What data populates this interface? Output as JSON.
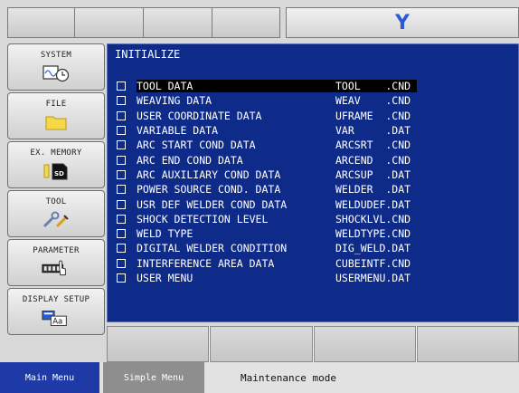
{
  "header": {
    "mode_letter": "Y",
    "mode_letter_color": "#2a5bd7"
  },
  "sidebar": {
    "items": [
      {
        "label": "SYSTEM",
        "icon": "system-monitor-clock-icon"
      },
      {
        "label": "FILE",
        "icon": "folder-icon"
      },
      {
        "label": "EX. MEMORY",
        "icon": "sd-card-icon"
      },
      {
        "label": "TOOL",
        "icon": "tools-icon"
      },
      {
        "label": "PARAMETER",
        "icon": "parameter-hand-icon"
      },
      {
        "label": "DISPLAY SETUP",
        "icon": "display-font-icon"
      }
    ]
  },
  "main": {
    "title": "INITIALIZE",
    "items": [
      {
        "name": "TOOL DATA",
        "file": "TOOL    .CND",
        "selected": true
      },
      {
        "name": "WEAVING DATA",
        "file": "WEAV    .CND"
      },
      {
        "name": "USER COORDINATE DATA",
        "file": "UFRAME  .CND"
      },
      {
        "name": "VARIABLE DATA",
        "file": "VAR     .DAT"
      },
      {
        "name": "ARC START COND DATA",
        "file": "ARCSRT  .CND"
      },
      {
        "name": "ARC END COND DATA",
        "file": "ARCEND  .CND"
      },
      {
        "name": "ARC AUXILIARY COND DATA",
        "file": "ARCSUP  .DAT"
      },
      {
        "name": "POWER SOURCE COND. DATA",
        "file": "WELDER  .DAT"
      },
      {
        "name": "USR DEF WELDER COND DATA",
        "file": "WELDUDEF.DAT"
      },
      {
        "name": "SHOCK DETECTION LEVEL",
        "file": "SHOCKLVL.CND"
      },
      {
        "name": "WELD TYPE",
        "file": "WELDTYPE.CND"
      },
      {
        "name": "DIGITAL WELDER CONDITION",
        "file": "DIG_WELD.DAT"
      },
      {
        "name": "INTERFERENCE AREA DATA",
        "file": "CUBEINTF.CND"
      },
      {
        "name": "USER MENU",
        "file": "USERMENU.DAT"
      }
    ]
  },
  "status_bar": {
    "main_menu": "Main Menu",
    "simple_menu": "Simple Menu",
    "mode": "Maintenance mode"
  },
  "colors": {
    "panel_bg": "#0f2b8a",
    "main_menu_bg": "#1d3aa6"
  }
}
